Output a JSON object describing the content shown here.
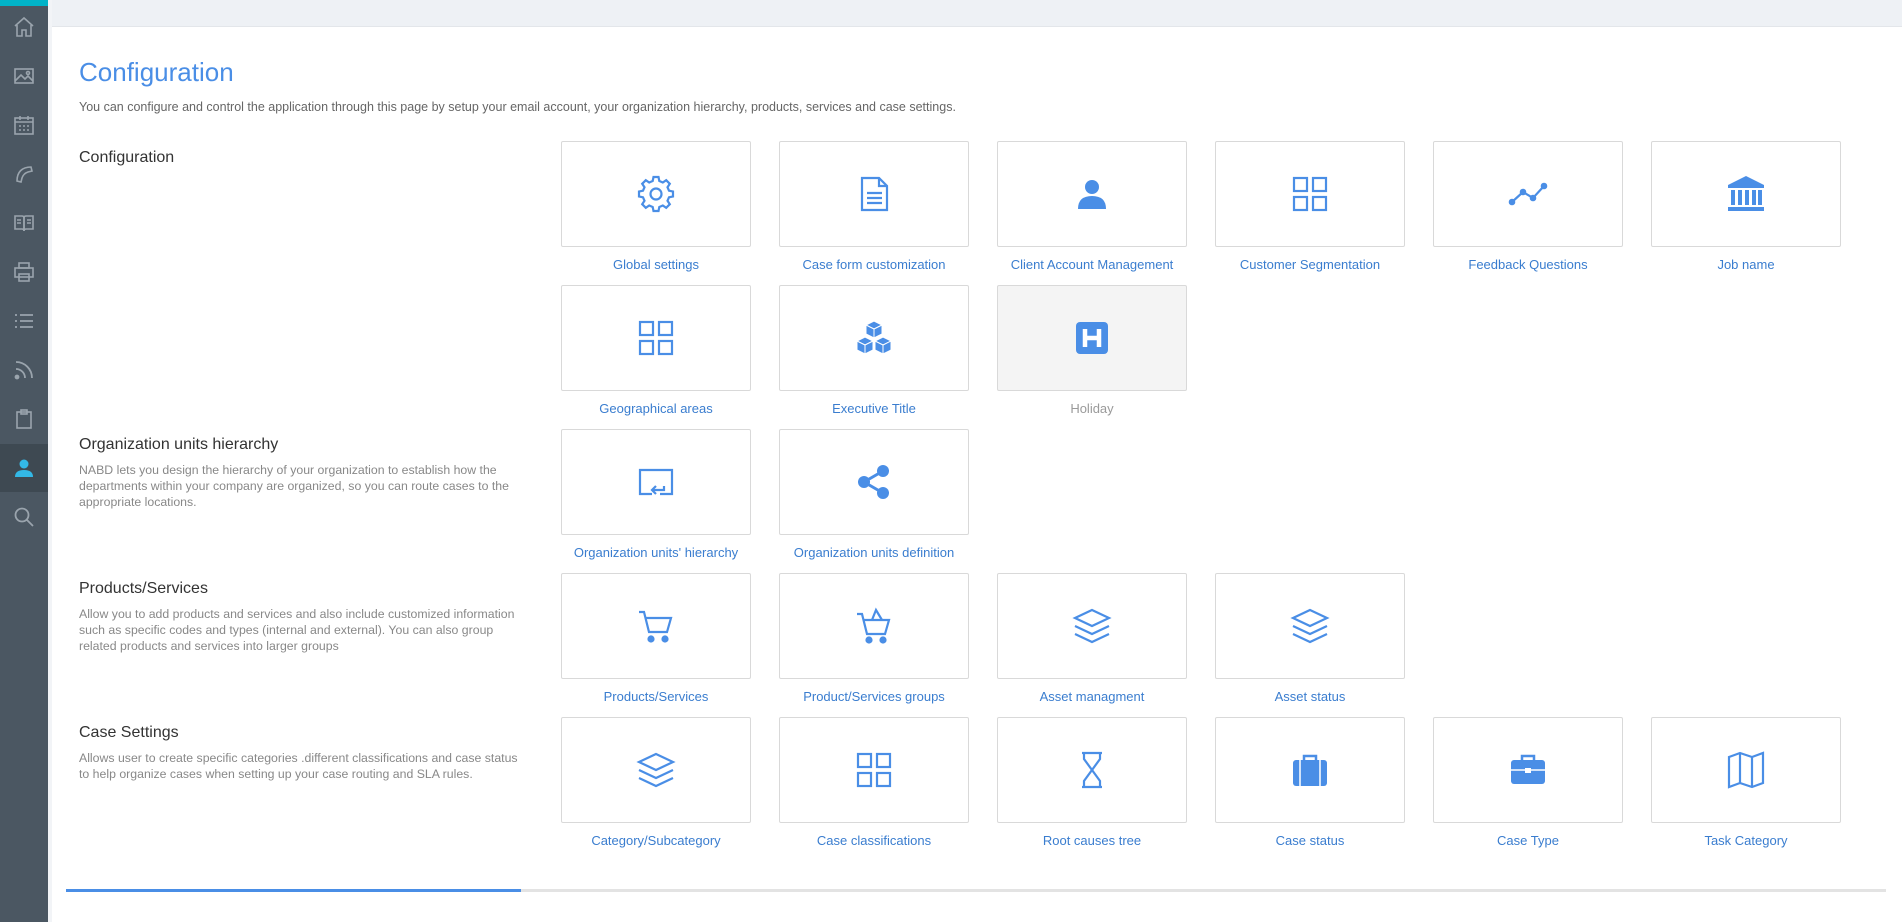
{
  "colors": {
    "accent": "#4a8ee6",
    "sidebar": "#4b5762",
    "tile_label": "#3a7dcf"
  },
  "sidebar": {
    "items": [
      {
        "icon": "home-icon"
      },
      {
        "icon": "image-icon"
      },
      {
        "icon": "calendar-icon"
      },
      {
        "icon": "phone-icon"
      },
      {
        "icon": "book-icon"
      },
      {
        "icon": "printer-icon"
      },
      {
        "icon": "list-icon"
      },
      {
        "icon": "rss-icon"
      },
      {
        "icon": "clipboard-icon"
      },
      {
        "icon": "user-icon",
        "active": true
      },
      {
        "icon": "search-icon"
      }
    ]
  },
  "page": {
    "title": "Configuration",
    "description": "You can configure and control the application through this page by setup your email account, your organization hierarchy, products, services and case settings."
  },
  "sections": {
    "configuration": {
      "title": "Configuration"
    },
    "org": {
      "title": "Organization units hierarchy",
      "description": "NABD lets you design the hierarchy of your organization to establish how the departments within your company are organized, so you can route cases to the appropriate locations."
    },
    "products": {
      "title": "Products/Services",
      "description": "Allow you to add products and services and also include customized information such as specific codes and types (internal and external). You can also group related products and services into larger groups"
    },
    "case": {
      "title": "Case Settings",
      "description": "Allows user to create specific categories .different classifications and case status to help organize cases when setting up your case routing and SLA rules."
    }
  },
  "tiles": {
    "global_settings": "Global settings",
    "case_form": "Case form customization",
    "client_account": "Client Account Management",
    "customer_segmentation": "Customer Segmentation",
    "feedback_questions": "Feedback Questions",
    "job_name": "Job name",
    "geo_areas": "Geographical areas",
    "executive_title": "Executive Title",
    "holiday": "Holiday",
    "org_hierarchy": "Organization units' hierarchy",
    "org_definition": "Organization units definition",
    "products_services": "Products/Services",
    "product_groups": "Product/Services groups",
    "asset_management": "Asset managment",
    "asset_status": "Asset status",
    "category": "Category/Subcategory",
    "case_classifications": "Case classifications",
    "root_causes": "Root causes tree",
    "case_status": "Case status",
    "case_type": "Case Type",
    "task_category": "Task Category"
  },
  "progress": {
    "fraction": 0.25
  }
}
